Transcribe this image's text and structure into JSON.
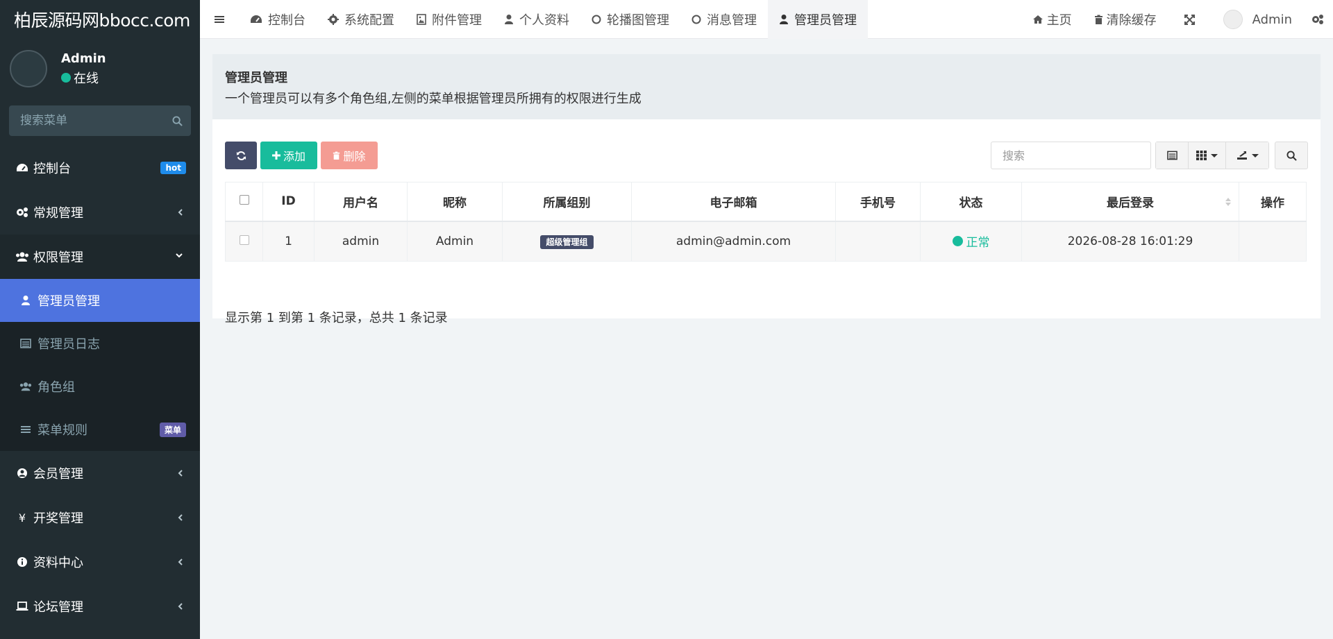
{
  "sidebar": {
    "logo": "柏辰源码网bbocc.com",
    "user": {
      "name": "Admin",
      "status": "在线"
    },
    "search_placeholder": "搜索菜单",
    "items": [
      {
        "label": "控制台",
        "icon": "dashboard-icon",
        "badge": "hot"
      },
      {
        "label": "常规管理",
        "icon": "cogs-icon"
      },
      {
        "label": "权限管理",
        "icon": "group-icon",
        "open": true,
        "children": [
          {
            "label": "管理员管理",
            "icon": "user-icon",
            "active": true
          },
          {
            "label": "管理员日志",
            "icon": "list-alt-icon"
          },
          {
            "label": "角色组",
            "icon": "group-icon"
          },
          {
            "label": "菜单规则",
            "icon": "bars-icon",
            "badge": "菜单"
          }
        ]
      },
      {
        "label": "会员管理",
        "icon": "user-circle-icon"
      },
      {
        "label": "开奖管理",
        "icon": "yen-icon"
      },
      {
        "label": "资料中心",
        "icon": "info-circle-icon"
      },
      {
        "label": "论坛管理",
        "icon": "laptop-icon"
      }
    ]
  },
  "topbar": {
    "tabs": [
      {
        "label": "控制台",
        "icon": "dashboard-icon"
      },
      {
        "label": "系统配置",
        "icon": "cog-icon"
      },
      {
        "label": "附件管理",
        "icon": "image-icon"
      },
      {
        "label": "个人资料",
        "icon": "user-icon"
      },
      {
        "label": "轮播图管理",
        "icon": "circle-icon"
      },
      {
        "label": "消息管理",
        "icon": "circle-icon"
      },
      {
        "label": "管理员管理",
        "icon": "user-icon",
        "active": true
      }
    ],
    "right": {
      "home": "主页",
      "clear_cache": "清除缓存",
      "user": "Admin"
    }
  },
  "page": {
    "title": "管理员管理",
    "description": "一个管理员可以有多个角色组,左侧的菜单根据管理员所拥有的权限进行生成"
  },
  "toolbar": {
    "add_label": "添加",
    "delete_label": "删除",
    "search_placeholder": "搜索"
  },
  "table": {
    "columns": [
      "ID",
      "用户名",
      "昵称",
      "所属组别",
      "电子邮箱",
      "手机号",
      "状态",
      "最后登录",
      "操作"
    ],
    "rows": [
      {
        "id": "1",
        "username": "admin",
        "nickname": "Admin",
        "group": "超级管理组",
        "email": "admin@admin.com",
        "mobile": "",
        "status": "正常",
        "last_login": "2026-08-28 16:01:29",
        "ops": ""
      }
    ]
  },
  "pagination": {
    "info": "显示第 1 到第 1 条记录，总共 1 条记录"
  },
  "colors": {
    "sidebar_bg": "#222d32",
    "active_item": "#4e73df",
    "success": "#18bc9c",
    "danger_light": "#f49c93",
    "primary_dark": "#444c69"
  }
}
